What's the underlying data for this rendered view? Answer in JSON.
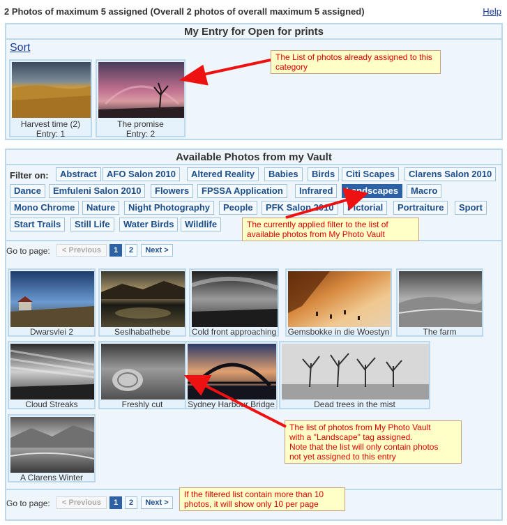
{
  "header": {
    "status": "2 Photos of maximum 5 assigned (Overall 2 photos of overall maximum 5 assigned)",
    "help": "Help"
  },
  "entry": {
    "title": "My Entry for Open for prints",
    "sort": "Sort",
    "photos": [
      {
        "title": "Harvest time (2)",
        "entry": "Entry: 1"
      },
      {
        "title": "The promise",
        "entry": "Entry: 2"
      }
    ]
  },
  "vault": {
    "title": "Available Photos from my Vault",
    "filter_label": "Filter on:",
    "filters": [
      "Abstract",
      "AFO Salon 2010",
      "Altered Reality",
      "Babies",
      "Birds",
      "Citi Scapes",
      "Clarens Salon 2010",
      "Dance",
      "Emfuleni Salon 2010",
      "Flowers",
      "FPSSA Application",
      "Infrared",
      "Landscapes",
      "Macro",
      "Mono Chrome",
      "Nature",
      "Night Photography",
      "People",
      "PFK Salon 2010",
      "Pictorial",
      "Portraiture",
      "Sport",
      "Start Trails",
      "Still Life",
      "Water Birds",
      "Wildlife"
    ],
    "active_filter": "Landscapes",
    "photos": [
      "Dwarsvlei 2",
      "Seslhabathebe",
      "Cold front approaching",
      "Gemsbokke in die Woestyn",
      "The farm",
      "Cloud Streaks",
      "Freshly cut",
      "Sydney Harbour Bridge",
      "Dead trees in the mist",
      "A Clarens Winter"
    ]
  },
  "pager": {
    "goto_label": "Go to page:",
    "previous": "< Previous",
    "pages": [
      "1",
      "2"
    ],
    "current": "1",
    "next": "Next >"
  },
  "callouts": {
    "assigned": "The List of photos already assigned to this category",
    "filter": "The currently applied filter to the list of available photos from My Photo Vault",
    "list_line1": "The list of photos from My Photo Vault",
    "list_line2": "with a \"Landscape\" tag assigned.",
    "list_line3": "Note that the list will only contain photos",
    "list_line4": "not yet assigned to this entry",
    "paging": "If the filtered list contain more than 10 photos, it will show only 10 per page"
  },
  "colors": {
    "panel_bg": "#eef5fb",
    "panel_border": "#bcd8ec",
    "link": "#1a3ea0",
    "tag_text": "#1c4f8c",
    "active_tag": "#2c62a5",
    "callout_bg": "#ffffc8",
    "callout_text": "#e00000",
    "arrow": "#ee1111"
  }
}
